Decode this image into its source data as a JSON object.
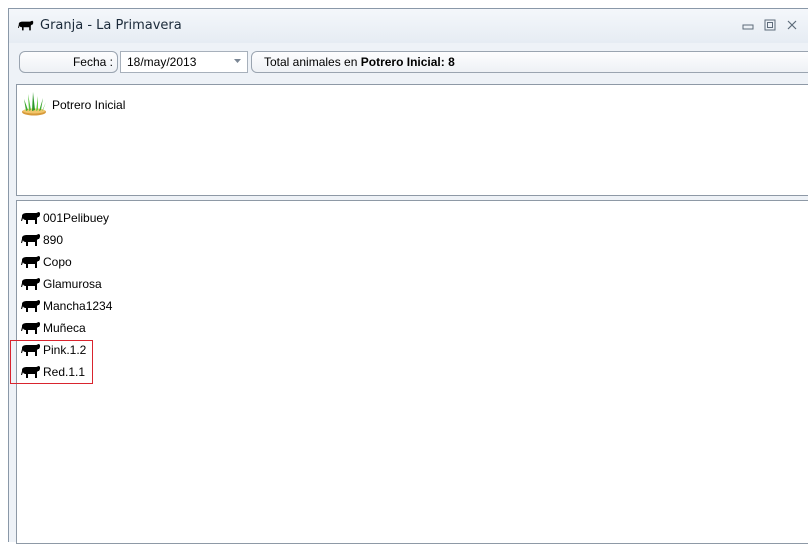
{
  "window": {
    "title": "Granja - La Primavera",
    "icon": "cow-icon",
    "controls": [
      "minimize-icon",
      "maximize-icon",
      "close-icon"
    ]
  },
  "toolbar": {
    "fecha_label": "Fecha :",
    "fecha_value": "18/may/2013",
    "total_prefix": "Total animales en",
    "total_location": "Potrero Inicial:",
    "total_count": "8"
  },
  "pastures": [
    {
      "label": "Potrero Inicial",
      "icon": "grass-icon"
    }
  ],
  "animals": [
    {
      "name": "001Pelibuey",
      "icon": "cow-icon"
    },
    {
      "name": "890",
      "icon": "cow-icon"
    },
    {
      "name": "Copo",
      "icon": "cow-icon"
    },
    {
      "name": "Glamurosa",
      "icon": "cow-icon"
    },
    {
      "name": "Mancha1234",
      "icon": "cow-icon"
    },
    {
      "name": "Muñeca",
      "icon": "cow-icon"
    },
    {
      "name": "Pink.1.2",
      "icon": "cow-icon"
    },
    {
      "name": "Red.1.1",
      "icon": "cow-icon"
    }
  ],
  "colors": {
    "highlight_border": "#d9242e",
    "window_background": "#eef2f7"
  }
}
